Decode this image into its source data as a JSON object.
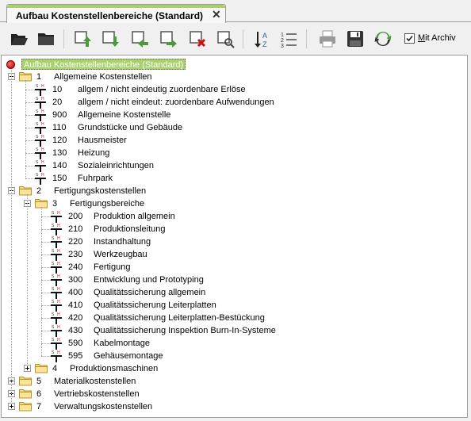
{
  "tab": {
    "title": "Aufbau Kostenstellenbereiche (Standard)",
    "close": "✕"
  },
  "toolbar": {
    "checkbox_label_prefix": "M",
    "checkbox_label_rest": "it Archiv",
    "checkbox_checked": true
  },
  "tree": {
    "root": "Aufbau Kostenstellenbereiche (Standard)",
    "groups": [
      {
        "num": "1",
        "label": "Allgemeine Kostenstellen",
        "expanded": true,
        "items": [
          {
            "num": "10",
            "label": "allgem / nicht eindeutig zuordenbare Erlöse"
          },
          {
            "num": "20",
            "label": "allgem / nicht eindeut: zuordenbare Aufwendungen"
          },
          {
            "num": "900",
            "label": "Allgemeine Kostenstelle"
          },
          {
            "num": "110",
            "label": "Grundstücke und Gebäude"
          },
          {
            "num": "120",
            "label": "Hausmeister"
          },
          {
            "num": "130",
            "label": "Heizung"
          },
          {
            "num": "140",
            "label": "Sozialeinrichtungen"
          },
          {
            "num": "150",
            "label": "Fuhrpark"
          }
        ]
      },
      {
        "num": "2",
        "label": "Fertigungskostenstellen",
        "expanded": true,
        "subgroups": [
          {
            "num": "3",
            "label": "Fertigungsbereiche",
            "expanded": true,
            "items": [
              {
                "num": "200",
                "label": "Produktion allgemein"
              },
              {
                "num": "210",
                "label": "Produktionsleitung"
              },
              {
                "num": "220",
                "label": "Instandhaltung"
              },
              {
                "num": "230",
                "label": "Werkzeugbau"
              },
              {
                "num": "240",
                "label": "Fertigung"
              },
              {
                "num": "300",
                "label": "Entwicklung und Prototyping"
              },
              {
                "num": "400",
                "label": "Qualitätssicherung allgemein"
              },
              {
                "num": "410",
                "label": "Qualitätssicherung Leiterplatten"
              },
              {
                "num": "420",
                "label": "Qualitätssicherung Leiterplatten-Bestückung"
              },
              {
                "num": "430",
                "label": "Qualitätssicherung Inspektion Burn-In-Systeme"
              },
              {
                "num": "590",
                "label": "Kabelmontage"
              },
              {
                "num": "595",
                "label": "Gehäusemontage"
              }
            ]
          },
          {
            "num": "4",
            "label": "Produktionsmaschinen",
            "expanded": false
          }
        ]
      },
      {
        "num": "5",
        "label": "Materialkostenstellen",
        "expanded": false
      },
      {
        "num": "6",
        "label": "Vertriebskostenstellen",
        "expanded": false
      },
      {
        "num": "7",
        "label": "Verwaltungskostenstellen",
        "expanded": false
      }
    ]
  },
  "icons": {
    "toolbar": [
      "open-folder-icon",
      "folder-icon",
      "move-up-icon",
      "move-down-icon",
      "move-left-icon",
      "move-right-icon",
      "delete-icon",
      "search-icon",
      "sort-az-icon",
      "numbered-list-icon",
      "print-icon",
      "save-icon",
      "refresh-icon"
    ],
    "tree": [
      "root-status-icon",
      "folder-icon",
      "cost-center-icon"
    ]
  },
  "colors": {
    "accent": "#a8d16c",
    "root_dot": "#cc0000",
    "icon_blue": "#1e5fa8",
    "icon_green": "#4a9a3a",
    "icon_red": "#cc1111"
  }
}
